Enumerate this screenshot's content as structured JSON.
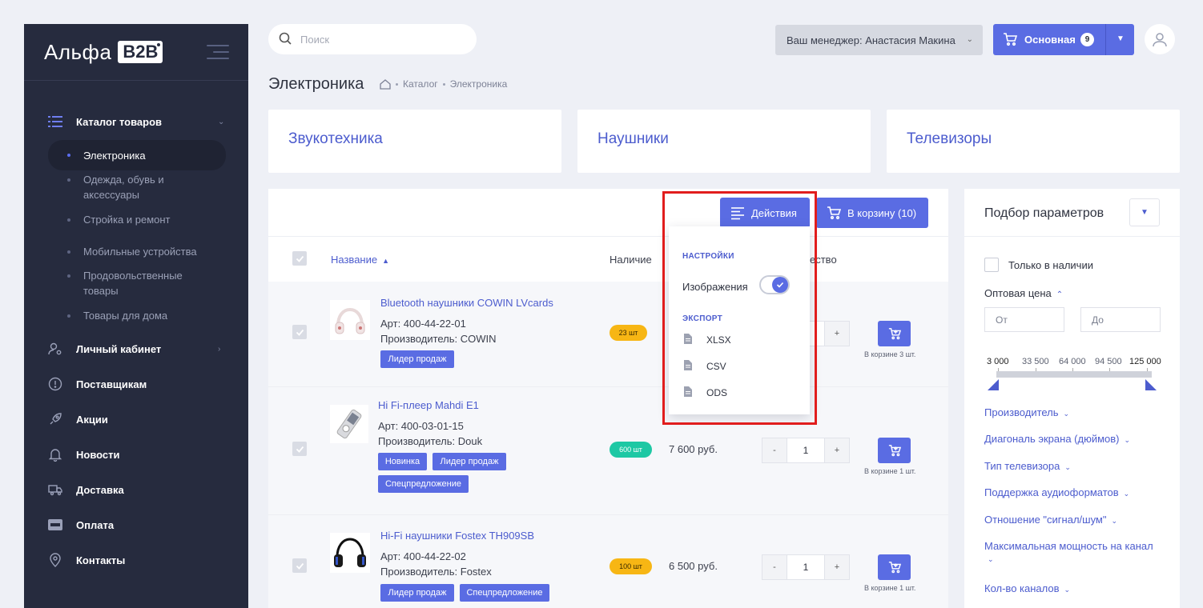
{
  "sidebar": {
    "logo_text": "Альфа",
    "logo_badge": "B2B",
    "catalog": {
      "label": "Каталог товаров"
    },
    "sub_items": [
      "Электроника",
      "Одежда, обувь и аксессуары",
      "Стройка и ремонт",
      "Мобильные устройства",
      "Продовольственные товары",
      "Товары для дома"
    ],
    "nav": {
      "account": "Личный кабинет",
      "suppliers": "Поставщикам",
      "promos": "Акции",
      "news": "Новости",
      "delivery": "Доставка",
      "payment": "Оплата",
      "contacts": "Контакты"
    }
  },
  "topbar": {
    "search_placeholder": "Поиск",
    "manager": "Ваш менеджер: Анастасия Макина",
    "cart_label": "Основная",
    "cart_count": "9"
  },
  "page": {
    "title": "Электроника",
    "breadcrumb": [
      "Каталог",
      "Электроника"
    ]
  },
  "categories": [
    "Звукотехника",
    "Наушники",
    "Телевизоры"
  ],
  "toolbar": {
    "actions": "Действия",
    "add_all": "В корзину (10)"
  },
  "table": {
    "col_name": "Название",
    "col_stock": "Наличие",
    "col_qty_partial": "ество"
  },
  "products": [
    {
      "name": "Bluetooth наушники COWIN LVcards",
      "art": "Арт: 400-44-22-01",
      "brand": "Производитель: COWIN",
      "tags": [
        "Лидер продаж"
      ],
      "stock": "23 шт",
      "price": "",
      "qty": "1",
      "in_cart": "В корзине 3 шт."
    },
    {
      "name": "Hi Fi-плеер Mahdi E1",
      "art": "Арт: 400-03-01-15",
      "brand": "Производитель: Douk",
      "tags": [
        "Новинка",
        "Лидер продаж",
        "Спецпредложение"
      ],
      "stock": "600 шт",
      "price": "7 600 руб.",
      "qty": "1",
      "in_cart": "В корзине 1 шт."
    },
    {
      "name": "Hi-Fi наушники Fostex TH909SB",
      "art": "Арт: 400-44-22-02",
      "brand": "Производитель: Fostex",
      "tags": [
        "Лидер продаж",
        "Спецпредложение"
      ],
      "stock": "100 шт",
      "price": "6 500 руб.",
      "qty": "1",
      "in_cart": "В корзине 1 шт."
    }
  ],
  "qty_minus": "-",
  "qty_plus": "+",
  "dropdown": {
    "settings_head": "НАСТРОЙКИ",
    "images_label": "Изображения",
    "images_on": true,
    "export_head": "ЭКСПОРТ",
    "formats": [
      "XLSX",
      "CSV",
      "ODS"
    ]
  },
  "filter": {
    "title": "Подбор параметров",
    "in_stock": "Только в наличии",
    "price_label": "Оптовая цена",
    "from_placeholder": "От",
    "to_placeholder": "До",
    "scale": [
      "3 000",
      "33 500",
      "64 000",
      "94 500",
      "125 000"
    ],
    "groups": [
      "Производитель",
      "Диагональ экрана (дюймов)",
      "Тип телевизора",
      "Поддержка аудиоформатов",
      "Отношение \"сигнал/шум\"",
      "Максимальная мощность на канал",
      "Кол-во каналов"
    ]
  },
  "colors": {
    "accent": "#5a6ce3",
    "sidebar_bg": "#262b3e",
    "highlight": "#e11d1d",
    "stock_yellow": "#f7b614",
    "stock_green": "#1ec8a4"
  }
}
